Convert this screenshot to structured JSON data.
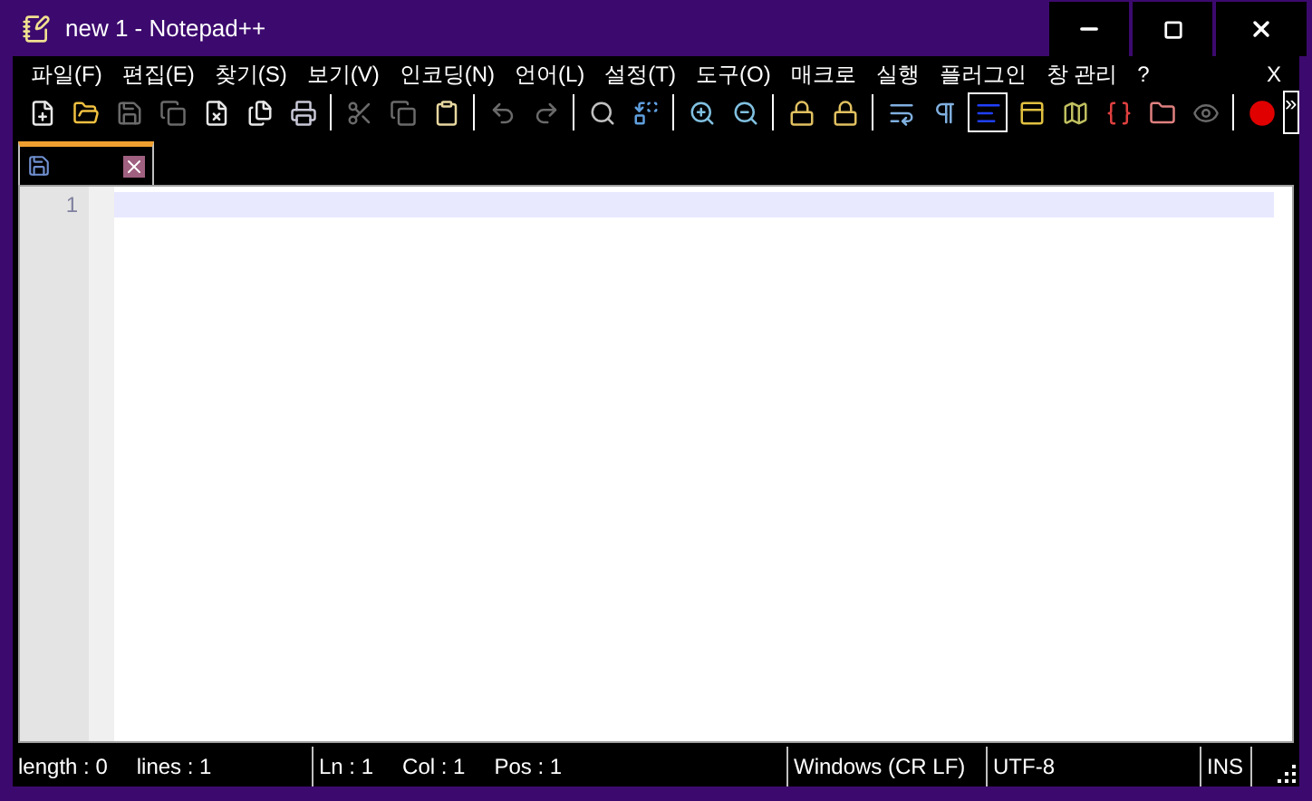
{
  "window": {
    "title": "new 1 - Notepad++"
  },
  "menu": {
    "items": [
      "파일(F)",
      "편집(E)",
      "찾기(S)",
      "보기(V)",
      "인코딩(N)",
      "언어(L)",
      "설정(T)",
      "도구(O)",
      "매크로",
      "실행",
      "플러그인",
      "창 관리",
      "?"
    ],
    "close_label": "X"
  },
  "toolbar": {
    "groups": [
      {
        "buttons": [
          {
            "disabled": false,
            "selected": false
          },
          {
            "disabled": false,
            "selected": false
          },
          {
            "disabled": true,
            "selected": false
          },
          {
            "disabled": true,
            "selected": false
          },
          {
            "disabled": false,
            "selected": false
          },
          {
            "disabled": false,
            "selected": false
          },
          {
            "disabled": false,
            "selected": false
          }
        ]
      },
      {
        "buttons": [
          {
            "disabled": true,
            "selected": false
          },
          {
            "disabled": true,
            "selected": false
          },
          {
            "disabled": false,
            "selected": false
          }
        ]
      },
      {
        "buttons": [
          {
            "disabled": true,
            "selected": false
          },
          {
            "disabled": true,
            "selected": false
          }
        ]
      },
      {
        "buttons": [
          {
            "disabled": false,
            "selected": false
          },
          {
            "disabled": false,
            "selected": false
          }
        ]
      },
      {
        "buttons": [
          {
            "disabled": false,
            "selected": false
          },
          {
            "disabled": false,
            "selected": false
          }
        ]
      },
      {
        "buttons": [
          {
            "disabled": false,
            "selected": false
          },
          {
            "disabled": false,
            "selected": false
          }
        ]
      },
      {
        "buttons": [
          {
            "disabled": false,
            "selected": false
          },
          {
            "disabled": false,
            "selected": false
          },
          {
            "disabled": false,
            "selected": true
          },
          {
            "disabled": false,
            "selected": false
          },
          {
            "disabled": false,
            "selected": false
          },
          {
            "disabled": false,
            "selected": false
          },
          {
            "disabled": false,
            "selected": false
          },
          {
            "disabled": true,
            "selected": false
          }
        ]
      },
      {
        "buttons": [
          {
            "disabled": false,
            "selected": false
          }
        ]
      }
    ],
    "overflow_label": "»"
  },
  "tabs": [
    {
      "selected": true
    }
  ],
  "editor": {
    "line_numbers": [
      "1"
    ]
  },
  "status_bar": {
    "sections": [
      {
        "items": [
          "length : 0",
          "lines : 1"
        ]
      },
      {
        "items": [
          "Ln : 1",
          "Col : 1",
          "Pos : 1"
        ]
      },
      {
        "items": [
          "Windows (CR LF)"
        ]
      },
      {
        "items": [
          "UTF-8"
        ]
      },
      {
        "items": [
          "INS"
        ]
      }
    ]
  }
}
